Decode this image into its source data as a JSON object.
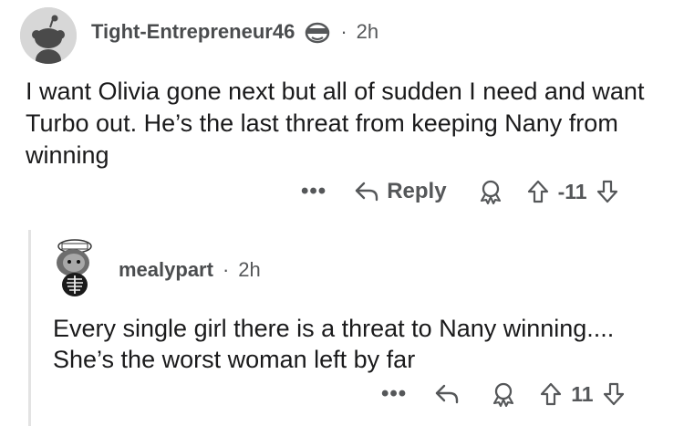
{
  "comment": {
    "username": "Tight-Entrepreneur46",
    "separator": "·",
    "time": "2h",
    "body": "I want Olivia gone next but all of sudden I need and want Turbo out. He’s the last threat from keeping Nany from winning",
    "actions": {
      "more": "•••",
      "reply_label": "Reply",
      "score": "-11"
    },
    "icons": {
      "avatar": "default-snoo-avatar-icon",
      "flair": "snoo-sunglasses-flair-icon",
      "reply": "reply-arrow-icon",
      "award": "award-icon",
      "upvote": "upvote-arrow-icon",
      "downvote": "downvote-arrow-icon"
    }
  },
  "reply": {
    "username": "mealypart",
    "separator": "·",
    "time": "2h",
    "body": "Every single girl there is a threat to Nany winning.... She’s the worst woman left by far",
    "actions": {
      "more": "•••",
      "score": "11"
    },
    "icons": {
      "avatar": "snoo-avatar-icon",
      "reply": "reply-arrow-icon",
      "award": "award-icon",
      "upvote": "upvote-arrow-icon",
      "downvote": "downvote-arrow-icon"
    }
  },
  "colors": {
    "text": "#1a1a1b",
    "meta": "#555759",
    "thread_line": "#e3e3e3",
    "avatar_bg": "#d7d7d7"
  }
}
